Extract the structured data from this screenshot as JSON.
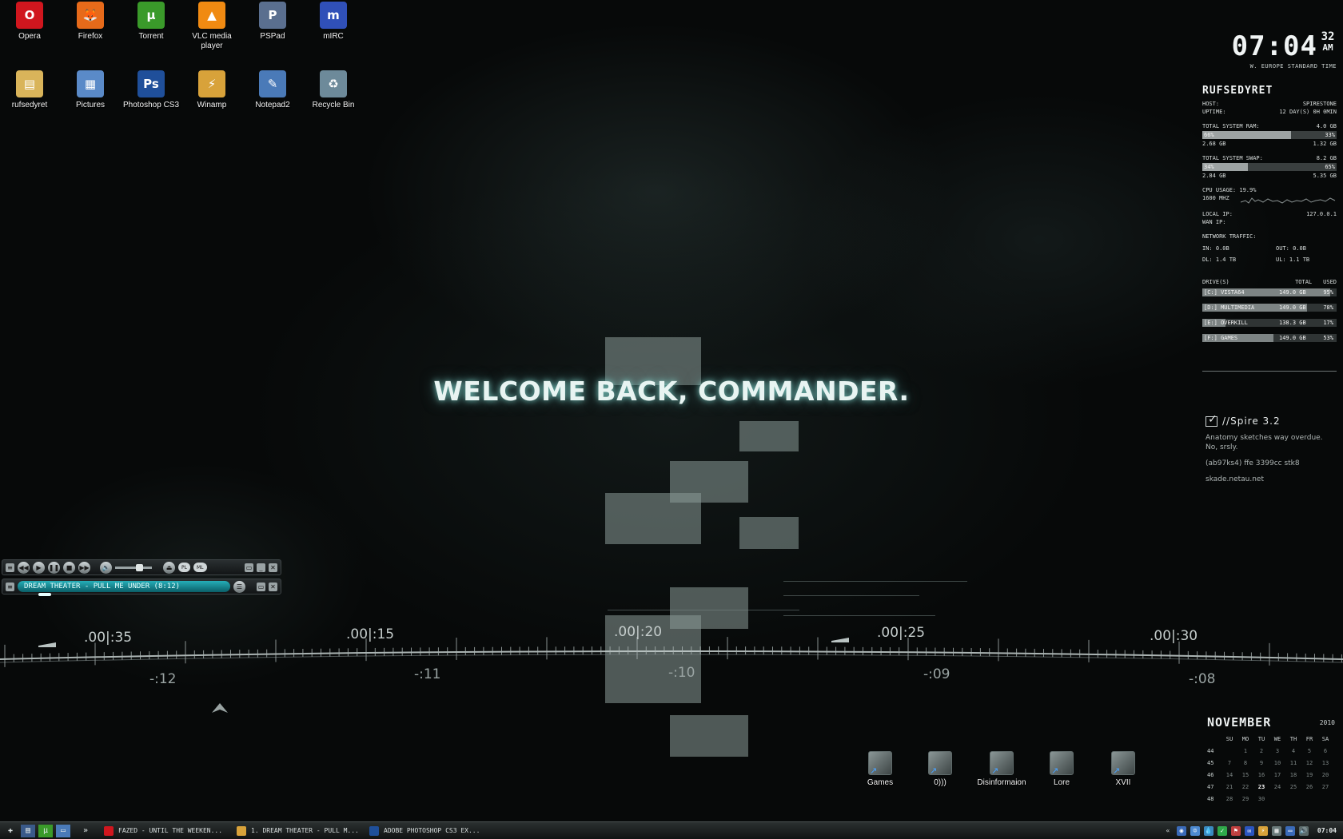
{
  "desktop": {
    "welcome_text": "WELCOME BACK, COMMANDER.",
    "icons": [
      {
        "label": "Opera",
        "icon": "opera-icon",
        "color": "#d0161e",
        "glyph": "O"
      },
      {
        "label": "Firefox",
        "icon": "firefox-icon",
        "color": "#e66a1a",
        "glyph": "🦊"
      },
      {
        "label": "Torrent",
        "icon": "torrent-icon",
        "color": "#3a9a2a",
        "glyph": "µ"
      },
      {
        "label": "VLC media player",
        "icon": "vlc-icon",
        "color": "#f08a12",
        "glyph": "▲"
      },
      {
        "label": "PSPad",
        "icon": "pspad-icon",
        "color": "#5a6f8f",
        "glyph": "P"
      },
      {
        "label": "mIRC",
        "icon": "mirc-icon",
        "color": "#3050b8",
        "glyph": "m"
      },
      {
        "label": "rufsedyret",
        "icon": "user-folder-icon",
        "color": "#d9b45a",
        "glyph": "▤"
      },
      {
        "label": "Pictures",
        "icon": "pictures-folder-icon",
        "color": "#5a8ac8",
        "glyph": "▦"
      },
      {
        "label": "Photoshop CS3",
        "icon": "photoshop-icon",
        "color": "#1f4f9a",
        "glyph": "Ps"
      },
      {
        "label": "Winamp",
        "icon": "winamp-icon",
        "color": "#d8a23a",
        "glyph": "⚡"
      },
      {
        "label": "Notepad2",
        "icon": "notepad-icon",
        "color": "#4a7ab8",
        "glyph": "✎"
      },
      {
        "label": "Recycle Bin",
        "icon": "recycle-bin-icon",
        "color": "#6d8a9a",
        "glyph": "♻"
      }
    ],
    "folders": [
      {
        "label": "Games",
        "icon": "games-folder-icon"
      },
      {
        "label": "0)))",
        "icon": "music-folder-icon"
      },
      {
        "label": "Disinformaion",
        "icon": "disinformation-folder-icon"
      },
      {
        "label": "Lore",
        "icon": "lore-folder-icon"
      },
      {
        "label": "XVII",
        "icon": "xvii-folder-icon"
      }
    ],
    "timeline_top": [
      ".00|:35",
      ".00|:15",
      ".00|:20",
      ".00|:25",
      ".00|:30"
    ],
    "timeline_bottom": [
      "-:12",
      "-:11",
      "-:10",
      "-:09",
      "-:08"
    ]
  },
  "clock": {
    "time": "07:04",
    "seconds": "32",
    "ampm": "AM",
    "zone": "W. EUROPE STANDARD TIME"
  },
  "sysmon": {
    "host_name": "RUFSEDYRET",
    "host_label": "HOST:",
    "host_value": "SPIRESTONE",
    "uptime_label": "UPTIME:",
    "uptime_value": "12 DAY(S) 0H 0MIN",
    "ram_label": "TOTAL SYSTEM RAM:",
    "ram_total": "4.0 GB",
    "ram_used_pct": "66%",
    "ram_free_pct": "33%",
    "ram_used_fraction": 0.66,
    "ram_used": "2.68 GB",
    "ram_free": "1.32 GB",
    "swap_label": "TOTAL SYSTEM SWAP:",
    "swap_total": "8.2 GB",
    "swap_used_pct": "34%",
    "swap_free_pct": "65%",
    "swap_used_fraction": 0.34,
    "swap_used": "2.84 GB",
    "swap_free": "5.35 GB",
    "cpu_label": "CPU USAGE: 19.9%",
    "cpu_freq": "1600 MHZ",
    "local_ip_label": "LOCAL IP:",
    "local_ip": "127.0.0.1",
    "wan_ip_label": "WAN IP:",
    "net_label": "NETWORK TRAFFIC:",
    "net_in": "IN: 0.0B",
    "net_out": "OUT: 0.0B",
    "net_dl": "DL: 1.4 TB",
    "net_ul": "UL: 1.1 TB",
    "drives_label": "DRIVE(S)",
    "drives_total_label": "TOTAL",
    "drives_used_label": "USED",
    "drives": [
      {
        "name": "[C:] VISTA64",
        "total": "149.0 GB",
        "used": "95%",
        "fraction": 0.95
      },
      {
        "name": "[D:] MULTIMEDIA",
        "total": "149.0 GB",
        "used": "78%",
        "fraction": 0.78
      },
      {
        "name": "[E:] OVERKILL",
        "total": "138.3 GB",
        "used": "17%",
        "fraction": 0.17
      },
      {
        "name": "[F:] GAMES",
        "total": "149.0 GB",
        "used": "53%",
        "fraction": 0.53
      }
    ]
  },
  "notes": {
    "title": "//Spire 3.2",
    "line1": "Anatomy sketches way overdue.",
    "line2": "No, srsly.",
    "line3": "(ab97ks4) ffe 3399cc stk8",
    "line4": "skade.netau.net"
  },
  "calendar": {
    "month": "NOVEMBER",
    "year": "2010",
    "days": [
      "SU",
      "MO",
      "TU",
      "WE",
      "TH",
      "FR",
      "SA"
    ],
    "weeks": [
      {
        "wk": "44",
        "d": [
          "",
          "1",
          "2",
          "3",
          "4",
          "5",
          "6"
        ]
      },
      {
        "wk": "45",
        "d": [
          "7",
          "8",
          "9",
          "10",
          "11",
          "12",
          "13"
        ]
      },
      {
        "wk": "46",
        "d": [
          "14",
          "15",
          "16",
          "17",
          "18",
          "19",
          "20"
        ]
      },
      {
        "wk": "47",
        "d": [
          "21",
          "22",
          "23",
          "24",
          "25",
          "26",
          "27"
        ]
      },
      {
        "wk": "48",
        "d": [
          "28",
          "29",
          "30",
          "",
          "",
          "",
          ""
        ]
      }
    ],
    "today": "23"
  },
  "winamp": {
    "track": "DREAM THEATER - PULL ME UNDER (8:12)",
    "eq_label": "EQ",
    "pl_label": "PL",
    "ml_label": "ML"
  },
  "taskbar": {
    "tasks": [
      {
        "label": "FAZED - UNTIL THE WEEKEN...",
        "icon": "opera-task-icon",
        "color": "#d0161e"
      },
      {
        "label": "1. DREAM THEATER - PULL M...",
        "icon": "winamp-task-icon",
        "color": "#d8a23a"
      },
      {
        "label": "ADOBE PHOTOSHOP CS3 EX...",
        "icon": "photoshop-task-icon",
        "color": "#1f4f9a"
      }
    ],
    "time": "07:04"
  }
}
